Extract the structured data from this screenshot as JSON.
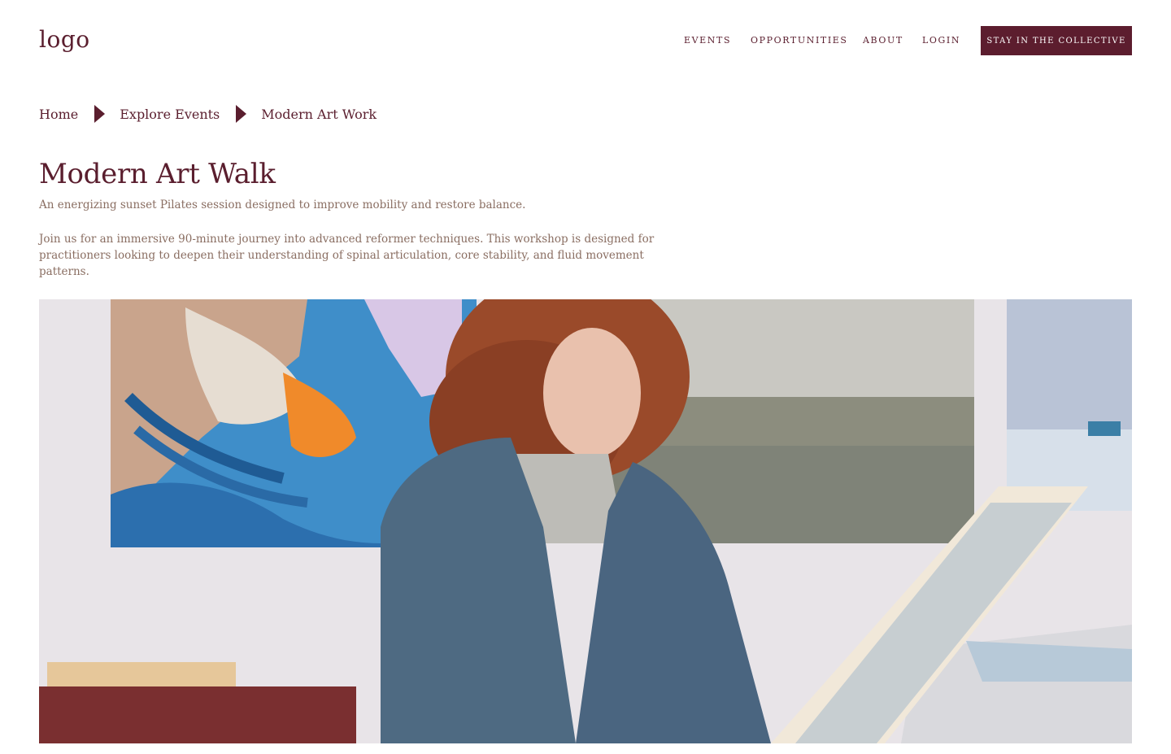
{
  "header": {
    "logo": "logo",
    "nav": [
      {
        "label": "EVENTS"
      },
      {
        "label": "OPPORTUNITIES"
      },
      {
        "label": "ABOUT"
      },
      {
        "label": "LOGIN"
      }
    ],
    "cta_label": "STAY IN THE COLLECTIVE"
  },
  "breadcrumb": {
    "items": [
      "Home",
      "Explore Events",
      "Modern Art Work"
    ]
  },
  "event": {
    "title": "Modern Art Walk",
    "subtitle": "An energizing sunset Pilates session designed to improve mobility and restore balance.",
    "description": "Join us for an immersive 90-minute journey into advanced reformer techniques. This workshop is designed for practitioners looking to deepen their understanding of spinal articulation, core stability, and fluid movement patterns."
  },
  "colors": {
    "brand": "#5c1d2e",
    "text_muted": "#8a6e62",
    "background": "#ffffff"
  }
}
